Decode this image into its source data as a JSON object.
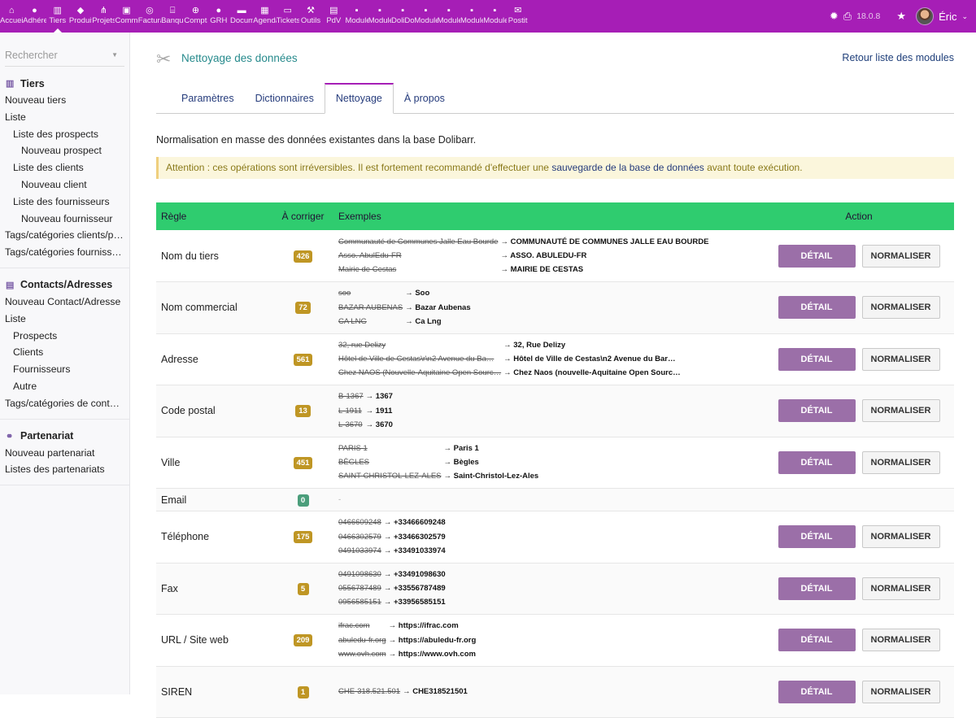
{
  "topbar": {
    "menu": [
      {
        "label": "Accueil",
        "icon": "home-icon",
        "g": "⌂"
      },
      {
        "label": "Adhérents",
        "icon": "user-icon",
        "g": "●"
      },
      {
        "label": "Tiers",
        "icon": "building-icon",
        "g": "▥"
      },
      {
        "label": "Produits",
        "icon": "cube-icon",
        "g": "◆"
      },
      {
        "label": "Projets",
        "icon": "sitemap-icon",
        "g": "⋔"
      },
      {
        "label": "Commerce",
        "icon": "briefcase-icon",
        "g": "▣"
      },
      {
        "label": "Facturation",
        "icon": "coins-icon",
        "g": "◎"
      },
      {
        "label": "Banque",
        "icon": "bank-icon",
        "g": "⌸"
      },
      {
        "label": "Compta",
        "icon": "search-dollar-icon",
        "g": "⊕"
      },
      {
        "label": "GRH",
        "icon": "user-tie-icon",
        "g": "●"
      },
      {
        "label": "Documents",
        "icon": "folder-icon",
        "g": "▬"
      },
      {
        "label": "Agenda",
        "icon": "calendar-icon",
        "g": "▦"
      },
      {
        "label": "Tickets",
        "icon": "ticket-icon",
        "g": "▭"
      },
      {
        "label": "Outils",
        "icon": "wrench-icon",
        "g": "⚒"
      },
      {
        "label": "PdV",
        "icon": "cash-register-icon",
        "g": "▤"
      },
      {
        "label": "Modules",
        "icon": "file-icon",
        "g": "▪"
      },
      {
        "label": "Modules",
        "icon": "file-icon",
        "g": "▪"
      },
      {
        "label": "DoliDoc",
        "icon": "file-icon",
        "g": "▪"
      },
      {
        "label": "Modules",
        "icon": "file-icon",
        "g": "▪"
      },
      {
        "label": "Modules",
        "icon": "file-icon",
        "g": "▪"
      },
      {
        "label": "Modules",
        "icon": "file-icon",
        "g": "▪"
      },
      {
        "label": "Modules",
        "icon": "file-icon",
        "g": "▪"
      },
      {
        "label": "Postit",
        "icon": "envelope-icon",
        "g": "✉"
      }
    ],
    "active_index": 2,
    "version": "18.0.8",
    "user": "Éric",
    "color": "#a61eb6"
  },
  "sidebar": {
    "search_placeholder": "Rechercher",
    "sections": [
      {
        "title": "Tiers",
        "icon": "building-icon",
        "items": [
          {
            "label": "Nouveau tiers",
            "level": 0
          },
          {
            "label": "Liste",
            "level": 0
          },
          {
            "label": "Liste des prospects",
            "level": 1
          },
          {
            "label": "Nouveau prospect",
            "level": 2
          },
          {
            "label": "Liste des clients",
            "level": 1
          },
          {
            "label": "Nouveau client",
            "level": 2
          },
          {
            "label": "Liste des fournisseurs",
            "level": 1
          },
          {
            "label": "Nouveau fournisseur",
            "level": 2
          },
          {
            "label": "Tags/catégories clients/prospects",
            "level": 0
          },
          {
            "label": "Tags/catégories fournisseurs",
            "level": 0
          }
        ]
      },
      {
        "title": "Contacts/Adresses",
        "icon": "address-card-icon",
        "items": [
          {
            "label": "Nouveau Contact/Adresse",
            "level": 0
          },
          {
            "label": "Liste",
            "level": 0
          },
          {
            "label": "Prospects",
            "level": 1
          },
          {
            "label": "Clients",
            "level": 1
          },
          {
            "label": "Fournisseurs",
            "level": 1
          },
          {
            "label": "Autre",
            "level": 1
          },
          {
            "label": "Tags/catégories de contacts",
            "level": 0
          }
        ]
      },
      {
        "title": "Partenariat",
        "icon": "handshake-icon",
        "items": [
          {
            "label": "Nouveau partenariat",
            "level": 0
          },
          {
            "label": "Listes des partenariats",
            "level": 0
          }
        ]
      }
    ]
  },
  "main": {
    "title": "Nettoyage des données",
    "back_link": "Retour liste des modules",
    "tabs": [
      "Paramètres",
      "Dictionnaires",
      "Nettoyage",
      "À propos"
    ],
    "active_tab": 2,
    "description": "Normalisation en masse des données existantes dans la base Dolibarr.",
    "warning": {
      "before": "Attention : ces opérations sont irréversibles. Il est fortement recommandé d'effectuer une ",
      "link": "sauvegarde de la base de données",
      "after": " avant toute exécution."
    },
    "table": {
      "headers": [
        "Règle",
        "À corriger",
        "Exemples",
        "Action"
      ],
      "detail_label": "DÉTAIL",
      "normalize_label": "NORMALISER",
      "rows": [
        {
          "rule": "Nom du tiers",
          "count": "426",
          "examples": [
            [
              "Communauté de Communes Jalle Eau Bourde",
              "COMMUNAUTÉ DE COMMUNES JALLE EAU BOURDE"
            ],
            [
              "Asso. AbulEdu-FR",
              "ASSO. ABULEDU-FR"
            ],
            [
              "Mairie de Cestas",
              "MAIRIE DE CESTAS"
            ]
          ]
        },
        {
          "rule": "Nom commercial",
          "count": "72",
          "examples": [
            [
              "soo",
              "Soo"
            ],
            [
              "BAZAR AUBENAS",
              "Bazar Aubenas"
            ],
            [
              "CA LNG",
              "Ca Lng"
            ]
          ]
        },
        {
          "rule": "Adresse",
          "count": "561",
          "examples": [
            [
              "32, rue Delizy",
              "32, Rue Delizy"
            ],
            [
              "Hôtel de Ville de Cestas\\r\\n2 Avenue du Ba…",
              "Hôtel de Ville de Cestas\\n2 Avenue du Bar…"
            ],
            [
              "Chez NAOS (Nouvelle-Aquitaine Open Sourc…",
              "Chez Naos (nouvelle-Aquitaine Open Sourc…"
            ]
          ]
        },
        {
          "rule": "Code postal",
          "count": "13",
          "examples": [
            [
              "B-1367",
              "1367"
            ],
            [
              "L-1911",
              "1911"
            ],
            [
              "L-3670",
              "3670"
            ]
          ]
        },
        {
          "rule": "Ville",
          "count": "451",
          "examples": [
            [
              "PARIS 1",
              "Paris 1"
            ],
            [
              "BÈGLES",
              "Bègles"
            ],
            [
              "SAINT-CHRISTOL-LEZ-ALES",
              "Saint-Christol-Lez-Ales"
            ]
          ]
        },
        {
          "rule": "Email",
          "count": "0",
          "empty": "-",
          "examples": []
        },
        {
          "rule": "Téléphone",
          "count": "175",
          "examples": [
            [
              "0466609248",
              "+33466609248"
            ],
            [
              "0466302579",
              "+33466302579"
            ],
            [
              "0491033974",
              "+33491033974"
            ]
          ]
        },
        {
          "rule": "Fax",
          "count": "5",
          "examples": [
            [
              "0491098630",
              "+33491098630"
            ],
            [
              "0556787489",
              "+33556787489"
            ],
            [
              "0956585151",
              "+33956585151"
            ]
          ]
        },
        {
          "rule": "URL / Site web",
          "count": "209",
          "examples": [
            [
              "ifrac.com",
              "https://ifrac.com"
            ],
            [
              "abuledu-fr.org",
              "https://abuledu-fr.org"
            ],
            [
              "www.ovh.com",
              "https://www.ovh.com"
            ]
          ]
        },
        {
          "rule": "SIREN",
          "count": "1",
          "examples": [
            [
              "CHE-318.521.501",
              "CHE318521501"
            ]
          ]
        }
      ]
    }
  }
}
